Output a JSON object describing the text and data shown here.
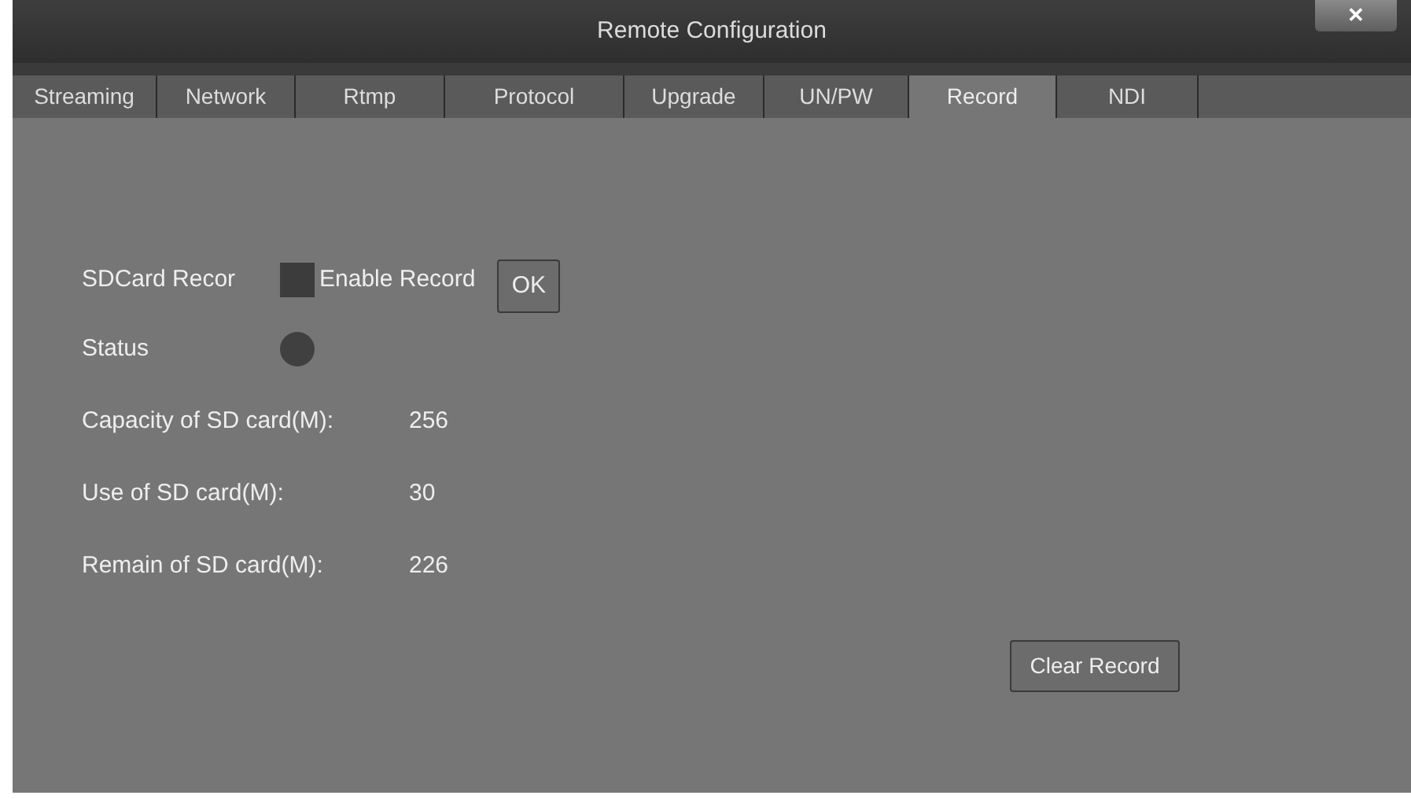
{
  "window": {
    "title": "Remote Configuration",
    "close": "✕"
  },
  "tabs": [
    {
      "label": "Streaming",
      "selected": false
    },
    {
      "label": "Network",
      "selected": false
    },
    {
      "label": "Rtmp",
      "selected": false
    },
    {
      "label": "Protocol",
      "selected": false
    },
    {
      "label": "Upgrade",
      "selected": false
    },
    {
      "label": "UN/PW",
      "selected": false
    },
    {
      "label": "Record",
      "selected": true
    },
    {
      "label": "NDI",
      "selected": false
    }
  ],
  "sdcard": {
    "label": "SDCard Recor",
    "checkbox_label": "Enable Record",
    "checked": false,
    "ok": "OK"
  },
  "status": {
    "label": "Status",
    "on": false
  },
  "info": [
    {
      "label": "Capacity of SD card(M):",
      "value": "256"
    },
    {
      "label": "Use of SD card(M):",
      "value": "30"
    },
    {
      "label": "Remain of SD card(M):",
      "value": "226"
    }
  ],
  "clear_button": "Clear Record"
}
